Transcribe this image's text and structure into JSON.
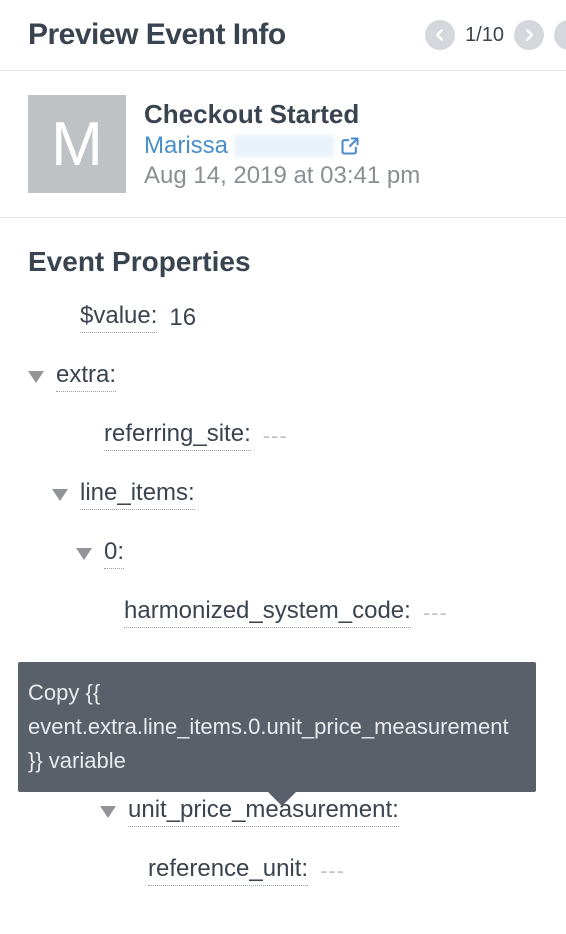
{
  "header": {
    "title": "Preview Event Info",
    "pager": "1/10"
  },
  "event": {
    "avatar_initial": "M",
    "name": "Checkout Started",
    "user_name": "Marissa",
    "timestamp": "Aug 14, 2019 at 03:41 pm"
  },
  "props": {
    "section_title": "Event Properties",
    "value_key": "$value:",
    "value_val": "16",
    "extra_key": "extra:",
    "referring_site_key": "referring_site:",
    "referring_site_val": "---",
    "line_items_key": "line_items:",
    "idx0_key": "0:",
    "hsc_key": "harmonized_system_code:",
    "hsc_val": "---",
    "upm_key": "unit_price_measurement:",
    "ref_unit_key": "reference_unit:",
    "ref_unit_val": "---"
  },
  "tooltip": {
    "text": "Copy {{ event.extra.line_items.0.unit_price_measurement }} variable"
  }
}
